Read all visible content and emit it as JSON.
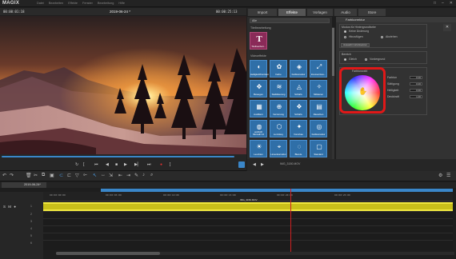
{
  "app": {
    "logo": "MAGIX"
  },
  "menu": [
    "Datei",
    "Bearbeiten",
    "Effekte",
    "Fenster",
    "Bearbeitung",
    "Hilfe"
  ],
  "window_buttons": [
    "□",
    "–",
    "✕"
  ],
  "preview": {
    "timecode_left": "00:00:01:18",
    "title": "2019-06-24 *",
    "timecode_right": "00:00:25:13",
    "scrub_progress": 0.97
  },
  "tabs": [
    {
      "label": "Import",
      "active": false
    },
    {
      "label": "Effekte",
      "active": true
    },
    {
      "label": "Vorlagen",
      "active": false
    },
    {
      "label": "Audio",
      "active": false
    },
    {
      "label": "Store",
      "active": false
    }
  ],
  "effects": {
    "filter": "Alle",
    "section_titles": "Titelbearbeitung",
    "title_tile": {
      "letter": "T",
      "label": "Titelbearbeit..."
    },
    "section_video": "Videoeffekte",
    "tiles": [
      [
        "Helligkeit/Kontrast",
        "Farbe",
        "Farbkorrektur",
        "Zoomen/Aus..."
      ],
      [
        "Bewegen",
        "Stabilisierung",
        "Schärfe",
        "Stilisieren"
      ],
      [
        "Ausfiltern",
        "Verzerrung",
        "Schärfe",
        "Rauschen"
      ],
      [
        "proDAD Mercalli V4",
        "Luminkey",
        "Vorschau",
        "Farbkorrektur"
      ],
      [
        "Leuchten",
        "Linsenkorrektur",
        "Blende",
        "Standard"
      ]
    ]
  },
  "color_panel": {
    "header": "Farbkorrektur",
    "group1_title": "Modus für Hintergrundfarbe",
    "group1_options": [
      "Keine Änderung",
      "Hinzufügen",
      "Abziehen"
    ],
    "reset_button": "Auswahl zurücksetzen",
    "close": "✕",
    "group2_title": "Bereich",
    "group2_options": [
      "Gleich",
      "Vordergrund"
    ],
    "wheel_title": "Farbtonwahl",
    "values": [
      "0.00",
      "0.00",
      "0.00",
      "1.00"
    ],
    "value_labels": [
      "Farbton",
      "Sättigung",
      "Helligkeit",
      "Deckkraft"
    ]
  },
  "rp_bottom": {
    "zoom": "100%",
    "file": "IMG_3150.MOV"
  },
  "timeline": {
    "tab": "2019-06-24*",
    "ruler_labels": [
      "00:00:00:00",
      "00:00:05:00",
      "00:00:10:00",
      "00:00:15:00",
      "00:00:20:00",
      "00:00:25:00"
    ],
    "track_controls": "S M ●",
    "track_numbers": [
      "1",
      "2",
      "3",
      "4",
      "5",
      "6"
    ],
    "clip_name": "IMG_3150.MOV"
  },
  "colors": {
    "accent": "#3a86c8",
    "highlight_frame": "#e01818",
    "clip": "#c9c01a",
    "title_tile": "#8a2a58"
  }
}
